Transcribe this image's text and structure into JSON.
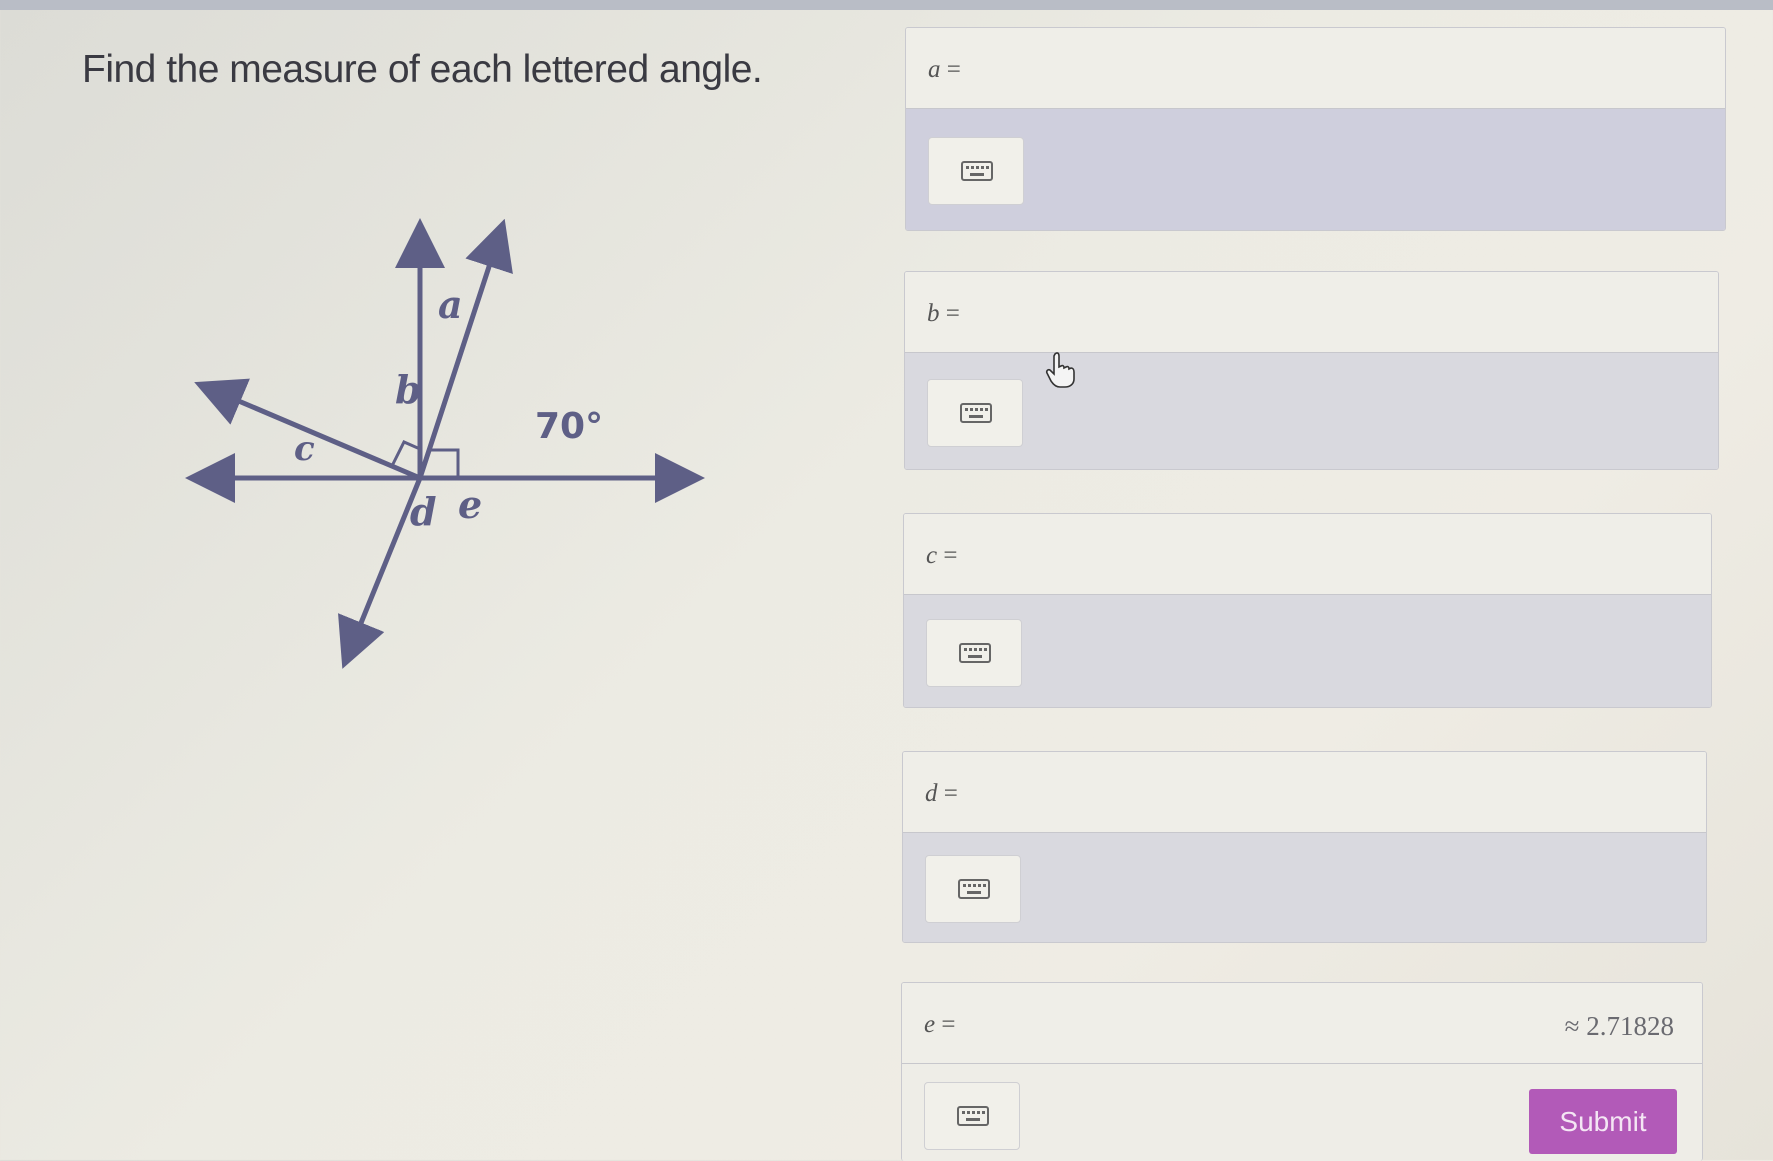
{
  "prompt": "Find the measure of each lettered angle.",
  "figure": {
    "labels": {
      "a": "a",
      "b": "b",
      "c": "c",
      "d": "d",
      "e": "e"
    },
    "given_angle": "70°",
    "line_color": "#5e5f86"
  },
  "answers": [
    {
      "var": "a",
      "eq": "=",
      "value": ""
    },
    {
      "var": "b",
      "eq": "=",
      "value": ""
    },
    {
      "var": "c",
      "eq": "=",
      "value": ""
    },
    {
      "var": "d",
      "eq": "=",
      "value": ""
    },
    {
      "var": "e",
      "eq": "=",
      "value": ""
    }
  ],
  "e_hint": "≈ 2.71828",
  "submit_label": "Submit",
  "colors": {
    "submit": "#b25ab8",
    "panel": "#d9d9df",
    "background": "#ecebe3"
  },
  "icons": {
    "keyboard": "keyboard-icon",
    "cursor": "hand-pointer-icon"
  }
}
